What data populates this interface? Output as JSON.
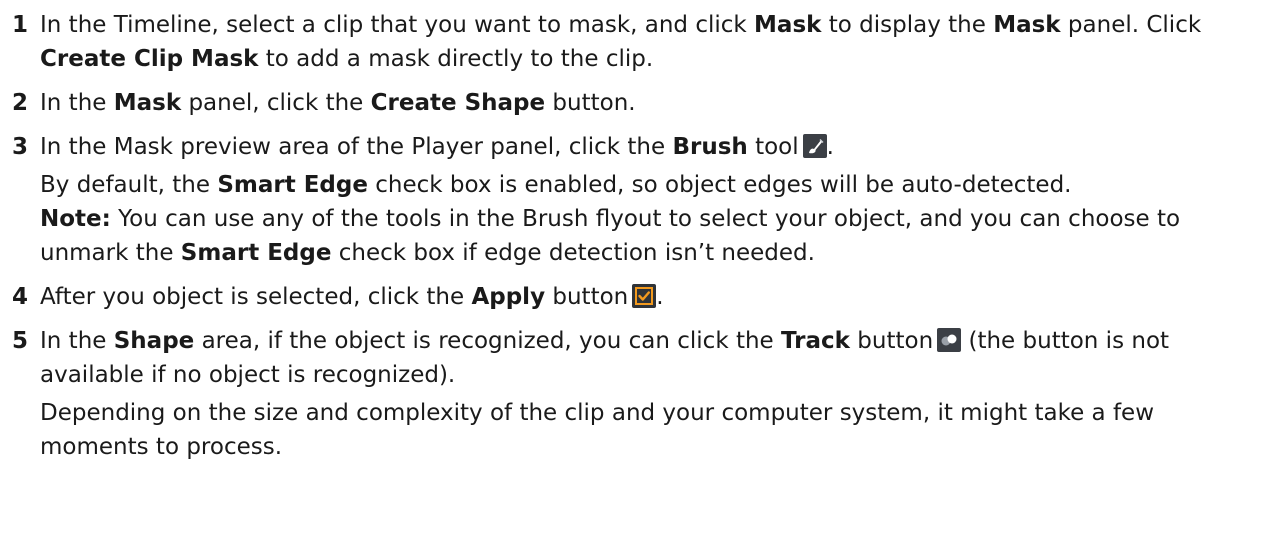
{
  "steps": [
    {
      "num": "1",
      "t1": "In the Timeline, select a clip that you want to mask, and click ",
      "b1": "Mask",
      "t2": " to display the ",
      "b2": "Mask",
      "t3": " panel. Click ",
      "b3": "Create Clip Mask",
      "t4": " to add a mask directly to the clip."
    },
    {
      "num": "2",
      "t1": "In the ",
      "b1": "Mask",
      "t2": " panel, click the ",
      "b2": "Create Shape",
      "t3": " button."
    },
    {
      "num": "3",
      "t1": "In the Mask preview area of the Player panel, click the ",
      "b1": "Brush",
      "t2": " tool",
      "t3": ".",
      "icon": "brush-icon"
    },
    {
      "num": "4",
      "t1": "After you object is selected, click the ",
      "b1": "Apply",
      "t2": " button",
      "t3": ".",
      "icon": "apply-checkbox-icon"
    },
    {
      "num": "5",
      "t1": "In the ",
      "b1": "Shape",
      "t2": " area, if the object is recognized, you can click the ",
      "b2": "Track",
      "t3": " button",
      "t4": " (the button is not available if no object is recognized).",
      "icon": "track-icon"
    }
  ],
  "step3_para": {
    "t1": "By default, the ",
    "b1": "Smart Edge",
    "t2": " check box is enabled, so object edges will be auto-detected."
  },
  "step3_note": {
    "label": "Note:",
    "t1": "  You can use any of the tools in the Brush flyout to select your object, and you can choose to unmark the ",
    "b1": "Smart Edge",
    "t2": " check box if edge detection isn’t needed."
  },
  "step5_para": {
    "t1": "Depending on the size and complexity of the clip and your computer system, it might take a few moments to process."
  },
  "colors": {
    "text": "#1a1a1a",
    "icon_bg": "#3b3f45",
    "apply_orange": "#f39a1e"
  }
}
